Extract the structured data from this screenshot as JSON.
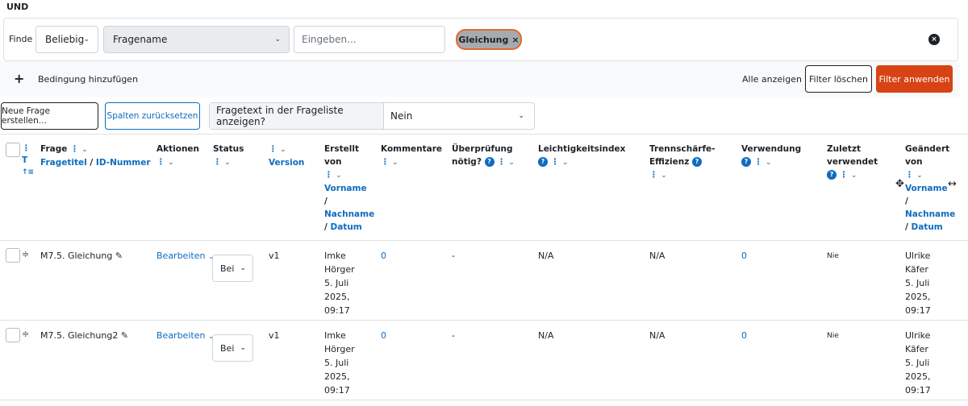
{
  "filter": {
    "conjunction": "UND",
    "find_label": "Finde",
    "match_select": "Beliebig",
    "field_select": "Fragename",
    "input_placeholder": "Eingeben...",
    "chip_label": "Gleichung",
    "chip_remove": "×",
    "clear_icon": "×"
  },
  "filter_actions": {
    "add_icon": "+",
    "add_condition": "Bedingung hinzufügen",
    "show_all": "Alle anzeigen",
    "clear_filters": "Filter löschen",
    "apply_filters": "Filter anwenden"
  },
  "toolbar": {
    "new_question": "Neue Frage erstellen...",
    "reset_columns": "Spalten zurücksetzen",
    "show_qtext_label": "Fragetext in der Frageliste anzeigen?",
    "show_qtext_value": "Nein"
  },
  "columns": {
    "t": "T",
    "sort_icon": "↑≡",
    "frage": "Frage",
    "fragetitel": "Fragetitel",
    "slash": "/",
    "id_nummer": "ID-Nummer",
    "aktionen": "Aktionen",
    "status": "Status",
    "version": "Version",
    "erstellt": "Erstellt",
    "von": "von",
    "vorname": "Vorname",
    "nachname": "Nachname",
    "datum": "Datum",
    "kommentare": "Kommentare",
    "ueberpruefung_1": "Überprüfung",
    "ueberpruefung_2": "nötig?",
    "leichtigkeit": "Leichtigkeitsindex",
    "trennschaerfe_1": "Trennschärfe-",
    "trennschaerfe_2": "Effizienz",
    "verwendung": "Verwendung",
    "zuletzt_1": "Zuletzt",
    "zuletzt_2": "verwendet",
    "geaendert": "Geändert",
    "dots": "⋮",
    "chev": "⌄",
    "help": "?"
  },
  "rows": [
    {
      "name": "M7.5. Gleichung",
      "action": "Bearbeiten",
      "status": "Bei",
      "version": "v1",
      "created_first": "Imke",
      "created_last": "Hörger",
      "created_date": "5. Juli",
      "created_year": "2025,",
      "created_time": "09:17",
      "comments": "0",
      "review": "-",
      "facility": "N/A",
      "discrimination": "N/A",
      "usage": "0",
      "last_used": "Nie",
      "modified_first": "Ulrike",
      "modified_last": "Käfer",
      "modified_date": "5. Juli",
      "modified_year": "2025,",
      "modified_time": "09:17"
    },
    {
      "name": "M7.5. Gleichung2",
      "action": "Bearbeiten",
      "status": "Bei",
      "version": "v1",
      "created_first": "Imke",
      "created_last": "Hörger",
      "created_date": "5. Juli",
      "created_year": "2025,",
      "created_time": "09:17",
      "comments": "0",
      "review": "-",
      "facility": "N/A",
      "discrimination": "N/A",
      "usage": "0",
      "last_used": "Nie",
      "modified_first": "Ulrike",
      "modified_last": "Käfer",
      "modified_date": "5. Juli",
      "modified_year": "2025,",
      "modified_time": "09:17"
    }
  ],
  "colors": {
    "link": "#0f6cbf",
    "apply_button": "#d84315",
    "chip_border": "#e06a2c"
  }
}
